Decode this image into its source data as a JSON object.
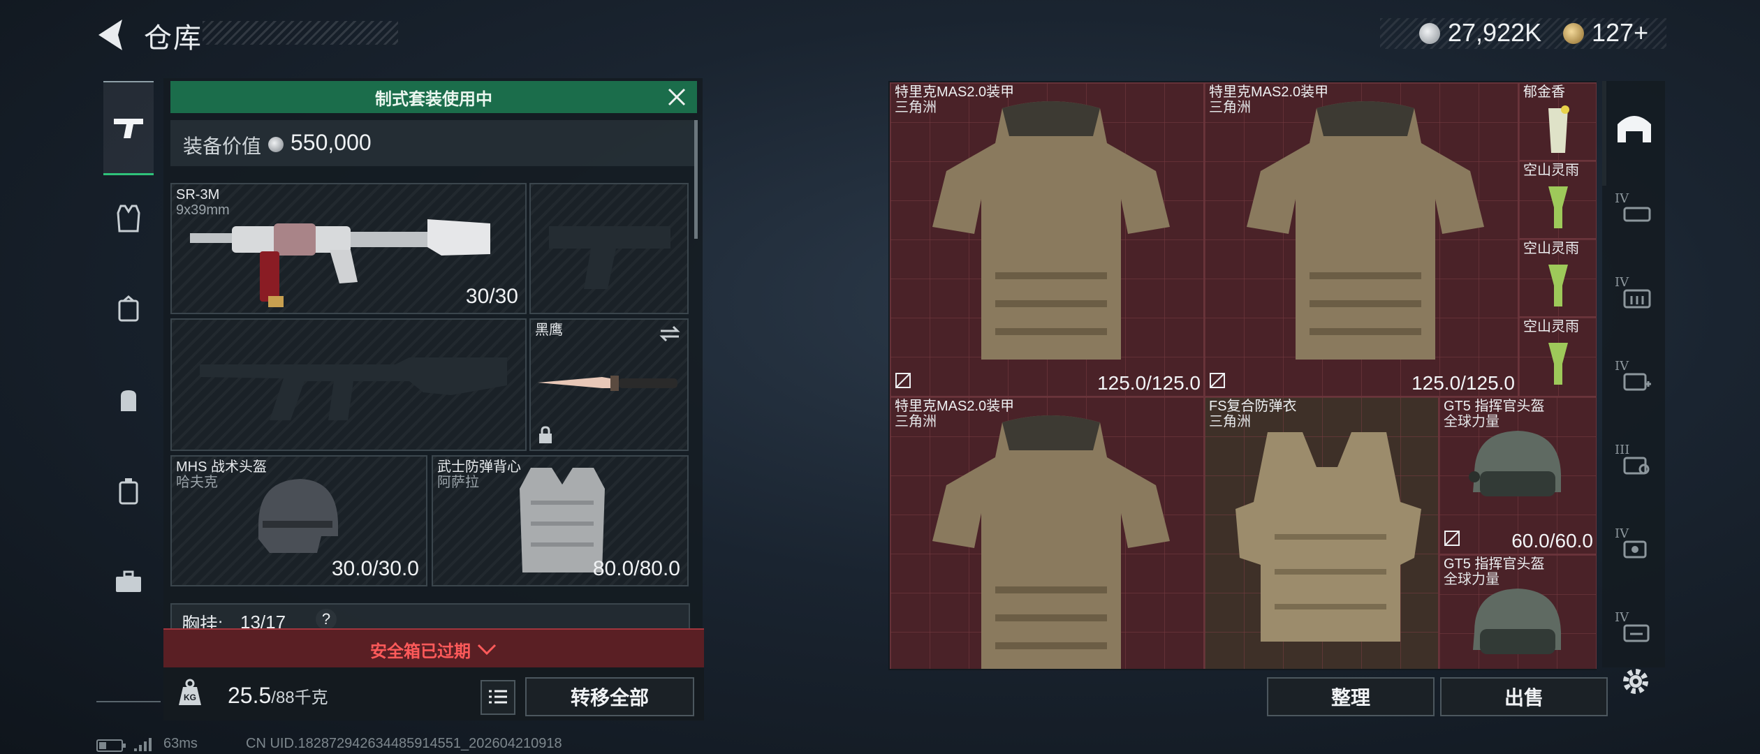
{
  "header": {
    "title": "仓库",
    "currency_primary": "27,922K",
    "currency_secondary": "127+",
    "coin_color": "#c5c9cc",
    "gold_color": "#c9a45a"
  },
  "nav": {
    "items": [
      {
        "name": "weapons-tab",
        "icon": "pistol-icon",
        "active": true
      },
      {
        "name": "armor-tab",
        "icon": "vest-icon",
        "active": false
      },
      {
        "name": "rig-tab",
        "icon": "rig-icon",
        "active": false
      },
      {
        "name": "backpack-tab",
        "icon": "backpack-icon",
        "active": false
      },
      {
        "name": "case-tab",
        "icon": "case-icon",
        "active": false
      },
      {
        "name": "toolbox-tab",
        "icon": "toolbox-icon",
        "active": false
      }
    ]
  },
  "loadout": {
    "banner": "制式套装使用中",
    "equip_value_label": "装备价值",
    "equip_value": "550,000",
    "primary": {
      "name": "SR-3M",
      "caliber": "9x39mm",
      "ammo": "30/30"
    },
    "knife": {
      "name": "黑鹰"
    },
    "helmet": {
      "name": "MHS 战术头盔",
      "sub": "哈夫克",
      "durability": "30.0/30.0"
    },
    "armor": {
      "name": "武士防弹背心",
      "sub": "阿萨拉",
      "durability": "80.0/80.0"
    },
    "chest_label": "胸挂:",
    "chest_value": "13/17",
    "chest_help": "?",
    "safebox_banner": "安全箱已过期",
    "weight_current": "25.5",
    "weight_max": "/88千克",
    "weight_icon_text": "KG",
    "transfer_all": "转移全部"
  },
  "storage": {
    "items": [
      {
        "name": "特里克MAS2.0装甲",
        "sub": "三角洲",
        "value": "125.0/125.0"
      },
      {
        "name": "特里克MAS2.0装甲",
        "sub": "三角洲",
        "value": "125.0/125.0"
      },
      {
        "name": "特里克MAS2.0装甲",
        "sub": "三角洲",
        "value": ""
      },
      {
        "name": "FS复合防弹衣",
        "sub": "三角洲",
        "value": ""
      },
      {
        "name": "GT5 指挥官头盔",
        "sub": "全球力量",
        "value": "60.0/60.0"
      },
      {
        "name": "GT5 指挥官头盔",
        "sub": "全球力量",
        "value": ""
      }
    ],
    "drinks": [
      {
        "name": "郁金香"
      },
      {
        "name": "空山灵雨"
      },
      {
        "name": "空山灵雨"
      },
      {
        "name": "空山灵雨"
      }
    ],
    "sort_label": "整理",
    "sell_label": "出售"
  },
  "rail": {
    "levels": [
      "IV",
      "IV",
      "IV",
      "III",
      "IV",
      "IV"
    ]
  },
  "footer": {
    "ping": "63ms",
    "uid": "CN UID.182872942634485914551_202604210918"
  }
}
